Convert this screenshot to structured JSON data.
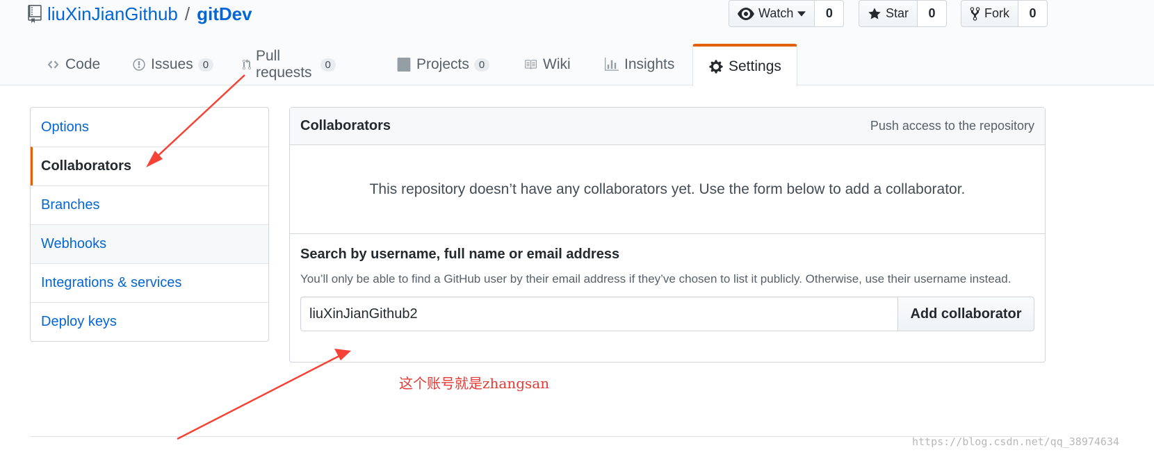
{
  "repo": {
    "owner": "liuXinJianGithub",
    "separator": "/",
    "name": "gitDev"
  },
  "actions": {
    "watch": {
      "label": "Watch",
      "count": "0"
    },
    "star": {
      "label": "Star",
      "count": "0"
    },
    "fork": {
      "label": "Fork",
      "count": "0"
    }
  },
  "tabs": {
    "code": {
      "label": "Code"
    },
    "issues": {
      "label": "Issues",
      "count": "0"
    },
    "pulls": {
      "label": "Pull requests",
      "count": "0"
    },
    "projects": {
      "label": "Projects",
      "count": "0"
    },
    "wiki": {
      "label": "Wiki"
    },
    "insights": {
      "label": "Insights"
    },
    "settings": {
      "label": "Settings"
    }
  },
  "sidebar": {
    "items": [
      {
        "label": "Options"
      },
      {
        "label": "Collaborators"
      },
      {
        "label": "Branches"
      },
      {
        "label": "Webhooks"
      },
      {
        "label": "Integrations & services"
      },
      {
        "label": "Deploy keys"
      }
    ]
  },
  "collaborators": {
    "title": "Collaborators",
    "note": "Push access to the repository",
    "empty_text": "This repository doesn’t have any collaborators yet. Use the form below to add a collaborator.",
    "search_title": "Search by username, full name or email address",
    "search_desc": "You’ll only be able to find a GitHub user by their email address if they’ve chosen to list it publicly. Otherwise, use their username instead.",
    "input_value": "liuXinJianGithub2",
    "add_label": "Add collaborator"
  },
  "annotation": {
    "text": "这个账号就是zhangsan",
    "color": "#e53935"
  },
  "watermark": "https://blog.csdn.net/qq_38974634",
  "colors": {
    "link": "#0366d6",
    "accent": "#e36209",
    "annotation_arrow": "#f44336"
  }
}
